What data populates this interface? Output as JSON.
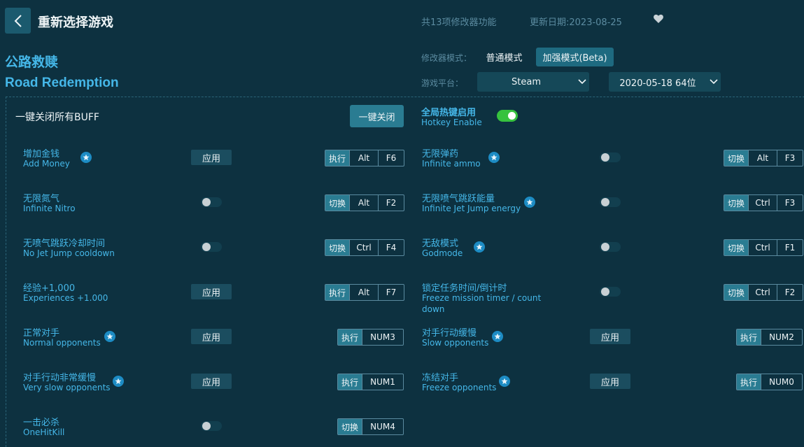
{
  "header": {
    "title": "重新选择游戏",
    "feature_count": "共13项修改器功能",
    "update_date": "更新日期:2023-08-25"
  },
  "game": {
    "name_cn": "公路救赎",
    "name_en": "Road Redemption"
  },
  "mode": {
    "label": "修改器模式：",
    "normal": "普通模式",
    "beta": "加强模式(Beta)",
    "active": "beta"
  },
  "platform": {
    "label": "游戏平台：",
    "selected": "Steam",
    "version": "2020-05-18 64位"
  },
  "buff": {
    "label": "一键关闭所有BUFF",
    "close_btn": "一键关闭"
  },
  "hotkey": {
    "label_cn": "全局热键启用",
    "label_en": "Hotkey Enable",
    "enabled": true
  },
  "controls": {
    "apply": "应用",
    "exec": "执行",
    "toggle": "切换"
  },
  "options": [
    {
      "cn": "增加金钱",
      "en": "Add Money",
      "star": true,
      "control": "apply",
      "action": "exec",
      "keys": [
        "Alt",
        "F6"
      ]
    },
    {
      "cn": "无限弹药",
      "en": "Infinite ammo",
      "star": true,
      "control": "toggle",
      "action": "toggle",
      "keys": [
        "Alt",
        "F3"
      ]
    },
    {
      "cn": "无限氮气",
      "en": "Infinite Nitro",
      "star": false,
      "control": "toggle",
      "action": "toggle",
      "keys": [
        "Alt",
        "F2"
      ]
    },
    {
      "cn": "无限喷气跳跃能量",
      "en": "Infinite Jet Jump energy",
      "star": true,
      "control": "toggle",
      "action": "toggle",
      "keys": [
        "Ctrl",
        "F3"
      ]
    },
    {
      "cn": "无喷气跳跃冷却时间",
      "en": "No Jet Jump cooldown",
      "star": false,
      "control": "toggle",
      "action": "toggle",
      "keys": [
        "Ctrl",
        "F4"
      ]
    },
    {
      "cn": "无敌模式",
      "en": "Godmode",
      "star": true,
      "control": "toggle",
      "action": "toggle",
      "keys": [
        "Ctrl",
        "F1"
      ]
    },
    {
      "cn": "经验+1,000",
      "en": "Experiences +1.000",
      "star": false,
      "control": "apply",
      "action": "exec",
      "keys": [
        "Alt",
        "F7"
      ]
    },
    {
      "cn": "锁定任务时间/倒计时",
      "en": "Freeze mission timer / count",
      "en2": "down",
      "star": false,
      "control": "toggle",
      "action": "toggle",
      "keys": [
        "Ctrl",
        "F2"
      ]
    },
    {
      "cn": "正常对手",
      "en": "Normal opponents",
      "star": true,
      "control": "apply",
      "action": "exec",
      "keys": [
        "NUM3"
      ]
    },
    {
      "cn": "对手行动缓慢",
      "en": "Slow opponents",
      "star": true,
      "control": "apply",
      "action": "exec",
      "keys": [
        "NUM2"
      ]
    },
    {
      "cn": "对手行动非常缓慢",
      "en": "Very slow opponents",
      "star": true,
      "control": "apply",
      "action": "exec",
      "keys": [
        "NUM1"
      ]
    },
    {
      "cn": "冻结对手",
      "en": "Freeze opponents",
      "star": true,
      "control": "apply",
      "action": "exec",
      "keys": [
        "NUM0"
      ]
    },
    {
      "cn": "一击必杀",
      "en": "OneHitKill",
      "star": false,
      "control": "toggle",
      "action": "toggle",
      "keys": [
        "NUM4"
      ]
    }
  ]
}
